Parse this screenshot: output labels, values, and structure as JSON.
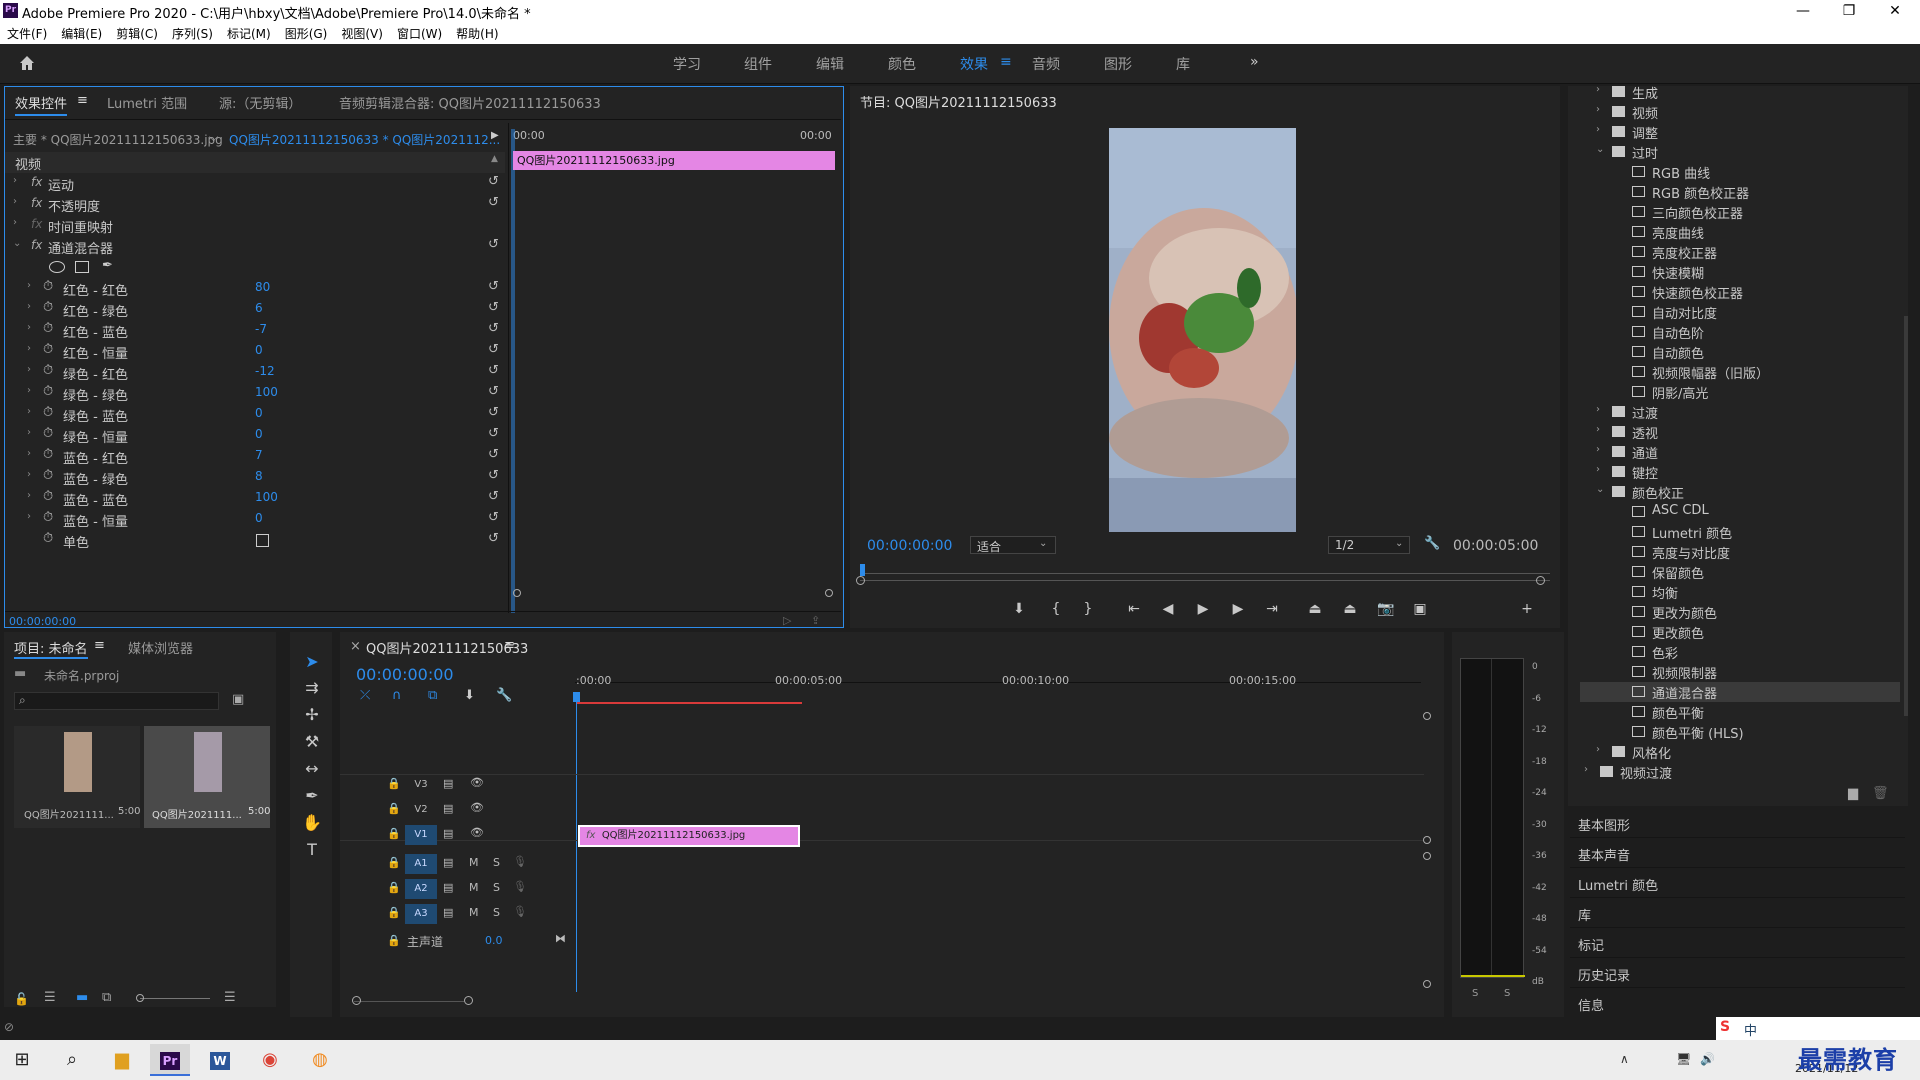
{
  "window": {
    "title": "Adobe Premiere Pro 2020 - C:\\用户\\hbxy\\文档\\Adobe\\Premiere Pro\\14.0\\未命名 *",
    "minimize": "—",
    "maximize": "❐",
    "close": "✕"
  },
  "menu": [
    "文件(F)",
    "编辑(E)",
    "剪辑(C)",
    "序列(S)",
    "标记(M)",
    "图形(G)",
    "视图(V)",
    "窗口(W)",
    "帮助(H)"
  ],
  "workspaces": {
    "items": [
      "学习",
      "组件",
      "编辑",
      "颜色",
      "效果",
      "音频",
      "图形",
      "库"
    ],
    "active": "效果",
    "more": "»"
  },
  "effect_controls": {
    "tabs": [
      "效果控件",
      "Lumetri 范围",
      "源:（无剪辑）",
      "音频剪辑混合器: QQ图片20211112150633"
    ],
    "master": "主要 * QQ图片20211112150633.jpg",
    "sequence": "QQ图片20211112150633 * QQ图片2021112...",
    "section": "视频",
    "tl_start": "00:00",
    "tl_end": "00:00",
    "clip_label": "QQ图片20211112150633.jpg",
    "effects": [
      "运动",
      "不透明度",
      "时间重映射",
      "通道混合器"
    ],
    "params": [
      {
        "label": "红色 - 红色",
        "value": "80"
      },
      {
        "label": "红色 - 绿色",
        "value": "6"
      },
      {
        "label": "红色 - 蓝色",
        "value": "-7"
      },
      {
        "label": "红色 - 恒量",
        "value": "0"
      },
      {
        "label": "绿色 - 红色",
        "value": "-12"
      },
      {
        "label": "绿色 - 绿色",
        "value": "100"
      },
      {
        "label": "绿色 - 蓝色",
        "value": "0"
      },
      {
        "label": "绿色 - 恒量",
        "value": "0"
      },
      {
        "label": "蓝色 - 红色",
        "value": "7"
      },
      {
        "label": "蓝色 - 绿色",
        "value": "8"
      },
      {
        "label": "蓝色 - 蓝色",
        "value": "100"
      },
      {
        "label": "蓝色 - 恒量",
        "value": "0"
      }
    ],
    "mono_label": "单色",
    "timecode": "00:00:00:00"
  },
  "program": {
    "title": "节目: QQ图片20211112150633",
    "timecode": "00:00:00:00",
    "fit": "适合",
    "quality": "1/2",
    "duration": "00:00:05:00"
  },
  "effects_tree": [
    {
      "level": 0,
      "type": "folder",
      "label": "生成",
      "open": false
    },
    {
      "level": 0,
      "type": "folder",
      "label": "视频",
      "open": false
    },
    {
      "level": 0,
      "type": "folder",
      "label": "调整",
      "open": false
    },
    {
      "level": 0,
      "type": "folder",
      "label": "过时",
      "open": true
    },
    {
      "level": 1,
      "type": "fx",
      "label": "RGB 曲线"
    },
    {
      "level": 1,
      "type": "fx",
      "label": "RGB 颜色校正器"
    },
    {
      "level": 1,
      "type": "fx",
      "label": "三向颜色校正器"
    },
    {
      "level": 1,
      "type": "fx",
      "label": "亮度曲线"
    },
    {
      "level": 1,
      "type": "fx",
      "label": "亮度校正器"
    },
    {
      "level": 1,
      "type": "fx",
      "label": "快速模糊"
    },
    {
      "level": 1,
      "type": "fx",
      "label": "快速颜色校正器"
    },
    {
      "level": 1,
      "type": "fx",
      "label": "自动对比度"
    },
    {
      "level": 1,
      "type": "fx",
      "label": "自动色阶"
    },
    {
      "level": 1,
      "type": "fx",
      "label": "自动颜色"
    },
    {
      "level": 1,
      "type": "fx",
      "label": "视频限幅器（旧版）"
    },
    {
      "level": 1,
      "type": "fx",
      "label": "阴影/高光"
    },
    {
      "level": 0,
      "type": "folder",
      "label": "过渡",
      "open": false
    },
    {
      "level": 0,
      "type": "folder",
      "label": "透视",
      "open": false
    },
    {
      "level": 0,
      "type": "folder",
      "label": "通道",
      "open": false
    },
    {
      "level": 0,
      "type": "folder",
      "label": "键控",
      "open": false
    },
    {
      "level": 0,
      "type": "folder",
      "label": "颜色校正",
      "open": true
    },
    {
      "level": 1,
      "type": "fx",
      "label": "ASC CDL"
    },
    {
      "level": 1,
      "type": "fx",
      "label": "Lumetri 颜色"
    },
    {
      "level": 1,
      "type": "fx",
      "label": "亮度与对比度"
    },
    {
      "level": 1,
      "type": "fx",
      "label": "保留颜色"
    },
    {
      "level": 1,
      "type": "fx",
      "label": "均衡"
    },
    {
      "level": 1,
      "type": "fx",
      "label": "更改为颜色"
    },
    {
      "level": 1,
      "type": "fx",
      "label": "更改颜色"
    },
    {
      "level": 1,
      "type": "fx",
      "label": "色彩"
    },
    {
      "level": 1,
      "type": "fx",
      "label": "视频限制器"
    },
    {
      "level": 1,
      "type": "fx",
      "label": "通道混合器",
      "selected": true
    },
    {
      "level": 1,
      "type": "fx",
      "label": "颜色平衡"
    },
    {
      "level": 1,
      "type": "fx",
      "label": "颜色平衡 (HLS)"
    },
    {
      "level": 0,
      "type": "folder",
      "label": "风格化",
      "open": false
    },
    {
      "level": -1,
      "type": "folder",
      "label": "视频过渡",
      "open": false
    }
  ],
  "right_sections": [
    "基本图形",
    "基本声音",
    "Lumetri 颜色",
    "库",
    "标记",
    "历史记录",
    "信息"
  ],
  "project": {
    "tabs": [
      "项目: 未命名",
      "媒体浏览器"
    ],
    "file": "未命名.prproj",
    "items": [
      {
        "name": "QQ图片2021111...",
        "duration": "5:00"
      },
      {
        "name": "QQ图片2021111...",
        "duration": "5:00"
      }
    ]
  },
  "timeline": {
    "tab": "QQ图片20211112150633",
    "timecode": "00:00:00:00",
    "ruler": [
      ":00:00",
      "00:00:05:00",
      "00:00:10:00",
      "00:00:15:00"
    ],
    "video_tracks": [
      "V3",
      "V2",
      "V1"
    ],
    "audio_tracks": [
      "A1",
      "A2",
      "A3"
    ],
    "master_label": "主声道",
    "master_value": "0.0",
    "clip_label": "QQ图片20211112150633.jpg",
    "m": "M",
    "s": "S"
  },
  "meter": {
    "scale": [
      "0",
      "-6",
      "-12",
      "-18",
      "-24",
      "-30",
      "-36",
      "-42",
      "-48",
      "-54",
      "dB"
    ],
    "s": "S"
  },
  "taskbar": {
    "time": "",
    "date": "2021/11/12",
    "ime": "中",
    "watermark": "最需教育"
  }
}
